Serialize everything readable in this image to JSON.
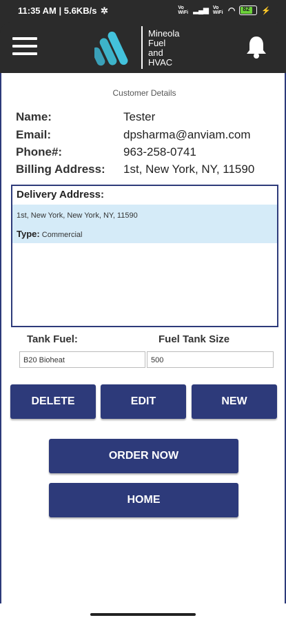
{
  "status": {
    "time_speed": "11:35 AM | 5.6KB/s",
    "signal1": "Vo WiFi",
    "signal2": "Vo WiFi",
    "battery": "82"
  },
  "header": {
    "logo_line1": "Mineola",
    "logo_line2": "Fuel",
    "logo_line3": "and",
    "logo_line4": "HVAC"
  },
  "customer": {
    "section_title": "Customer Details",
    "name_label": "Name:",
    "name_value": "Tester",
    "email_label": "Email:",
    "email_value": "dpsharma@anviam.com",
    "phone_label": "Phone#:",
    "phone_value": "963-258-0741",
    "billing_label": "Billing Address:",
    "billing_value": "1st, New York, NY, 11590"
  },
  "delivery": {
    "title": "Delivery Address:",
    "items": [
      {
        "address": "1st, New York, New York, NY, 11590",
        "type_label": "Type:",
        "type_value": "Commercial"
      }
    ]
  },
  "tank": {
    "fuel_label": "Tank Fuel:",
    "size_label": "Fuel Tank Size",
    "fuel_value": "B20 Bioheat",
    "size_value": "500"
  },
  "buttons": {
    "delete": "DELETE",
    "edit": "EDIT",
    "new": "NEW",
    "order_now": "ORDER NOW",
    "home": "HOME"
  },
  "colors": {
    "primary": "#2d3a7a",
    "selected_row": "#d5ebf8",
    "header_bg": "#2b2b2b"
  }
}
